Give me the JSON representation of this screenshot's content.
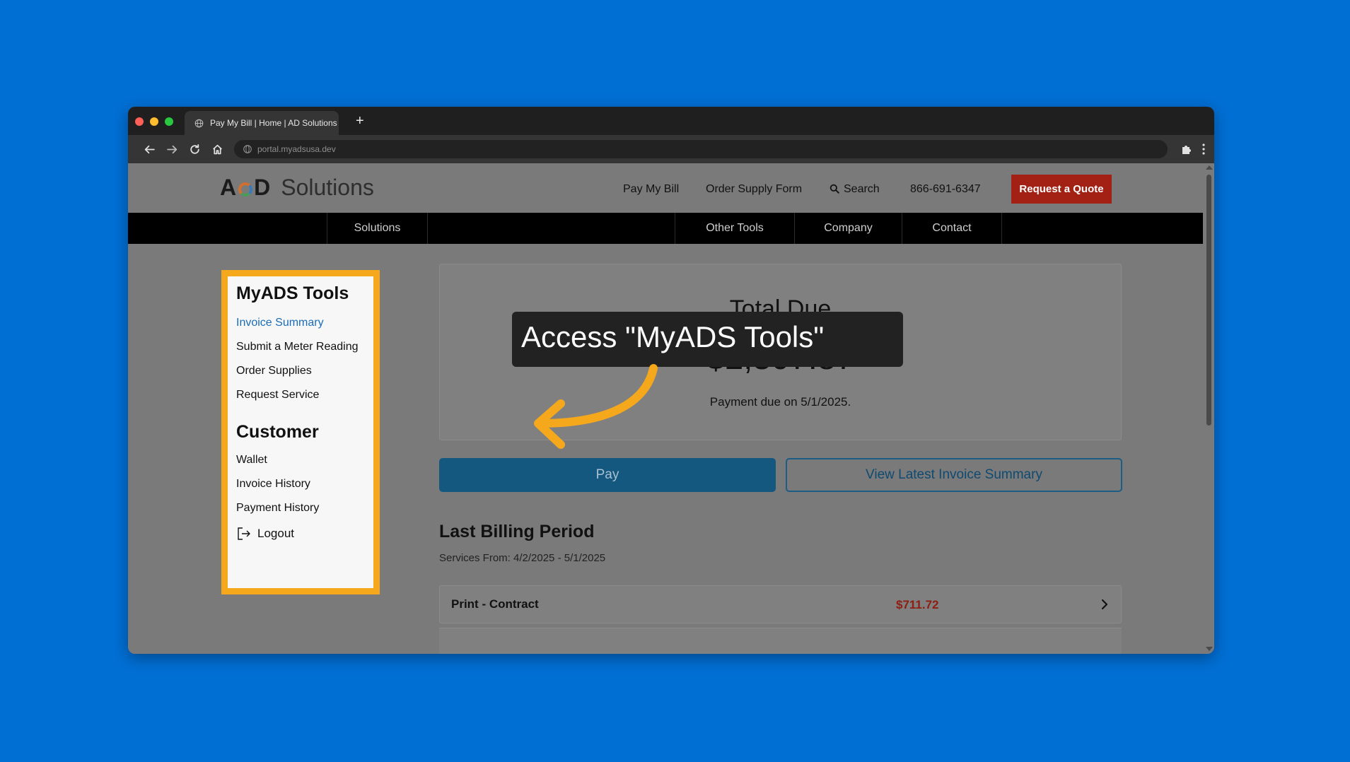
{
  "browser": {
    "tab_title": "Pay My Bill | Home | AD Solutions",
    "new_tab": "+",
    "url": "portal.myadsusa.dev"
  },
  "site": {
    "logo_left": "A",
    "logo_right": "D",
    "logo_word": "Solutions",
    "top_links": {
      "pay_my_bill": "Pay My Bill",
      "order_supply_form": "Order Supply Form",
      "search": "Search",
      "phone": "866-691-6347"
    },
    "quote_button": "Request a Quote",
    "main_nav": {
      "solutions": "Solutions",
      "other_tools": "Other Tools",
      "company": "Company",
      "contact": "Contact"
    }
  },
  "sidebar": {
    "tools_heading": "MyADS Tools",
    "tools": [
      {
        "label": "Invoice Summary"
      },
      {
        "label": "Submit a Meter Reading"
      },
      {
        "label": "Order Supplies"
      },
      {
        "label": "Request Service"
      }
    ],
    "customer_heading": "Customer",
    "customer": [
      {
        "label": "Wallet"
      },
      {
        "label": "Invoice History"
      },
      {
        "label": "Payment History"
      }
    ],
    "logout": "Logout"
  },
  "summary": {
    "label": "Total Due",
    "amount": "$2,307.87",
    "due_text": "Payment due on 5/1/2025."
  },
  "actions": {
    "pay": "Pay",
    "view": "View Latest Invoice Summary"
  },
  "billing": {
    "title": "Last Billing Period",
    "services": "Services From: 4/2/2025 - 5/1/2025",
    "lines": [
      {
        "label": "Print - Contract",
        "amount": "$711.72"
      }
    ]
  },
  "callout": {
    "text": "Access \"MyADS Tools\""
  },
  "colors": {
    "page_background": "#006fd4",
    "highlight": "#f6a81d",
    "quote_button": "#a32114",
    "link_active": "#1a6cb8"
  }
}
